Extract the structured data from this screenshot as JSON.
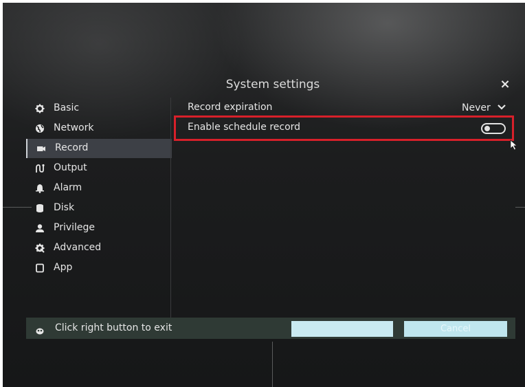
{
  "dialog": {
    "title": "System settings",
    "close_glyph": "×"
  },
  "sidebar": {
    "items": [
      {
        "label": "Basic",
        "icon": "gear-icon",
        "active": false
      },
      {
        "label": "Network",
        "icon": "globe-icon",
        "active": false
      },
      {
        "label": "Record",
        "icon": "camera-icon",
        "active": true
      },
      {
        "label": "Output",
        "icon": "output-icon",
        "active": false
      },
      {
        "label": "Alarm",
        "icon": "bell-icon",
        "active": false
      },
      {
        "label": "Disk",
        "icon": "disk-icon",
        "active": false
      },
      {
        "label": "Privilege",
        "icon": "user-icon",
        "active": false
      },
      {
        "label": "Advanced",
        "icon": "advanced-gear-icon",
        "active": false
      },
      {
        "label": "App",
        "icon": "app-icon",
        "active": false
      }
    ]
  },
  "settings": {
    "record_expiration": {
      "label": "Record expiration",
      "value": "Never"
    },
    "enable_schedule_record": {
      "label": "Enable schedule record",
      "enabled": false
    }
  },
  "footer": {
    "hint": "Click right button to exit",
    "ok_label": "",
    "cancel_label": "Cancel"
  },
  "colors": {
    "highlight": "#d8202a",
    "active_item": "#3d4046",
    "footer_bar": "#2f3a35",
    "button": "#c9eaf1"
  }
}
